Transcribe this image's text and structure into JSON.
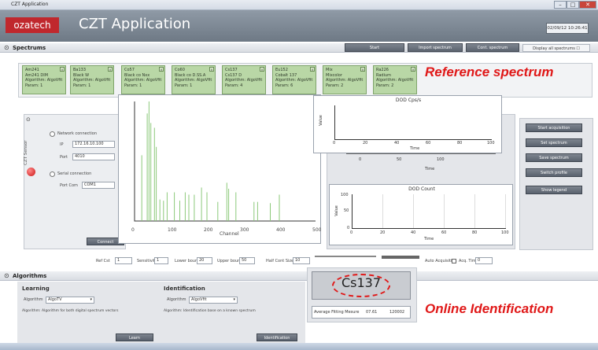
{
  "window": {
    "title": "CZT Application"
  },
  "header": {
    "logo": "ozatech",
    "app_title": "CZT Application",
    "datetime": "02/09/12 10:26:41"
  },
  "spectrums": {
    "label": "Spectrums",
    "buttons": [
      "Start",
      "Import spectrum",
      "Cont. spectrum",
      "Display all spectrums"
    ],
    "cards": [
      {
        "l1": "Am241",
        "l2": "Am241 DIM",
        "l3": "Algorithm: AlgoVfit",
        "l4": "Param: 1"
      },
      {
        "l1": "Ba133",
        "l2": "Black W",
        "l3": "Algorithm: AlgoVfit",
        "l4": "Param: 1"
      },
      {
        "l1": "Co57",
        "l2": "Black co Nxx",
        "l3": "Algorithm: AlgoVfit",
        "l4": "Param: 1"
      },
      {
        "l1": "Co60",
        "l2": "Black co D.SS.A",
        "l3": "Algorithm: AlgoVfit",
        "l4": "Param: 1"
      },
      {
        "l1": "Cs137",
        "l2": "Cs137 D",
        "l3": "Algorithm: AlgoVfit",
        "l4": "Param: 4"
      },
      {
        "l1": "Eu152",
        "l2": "Cobalt 137",
        "l3": "Algorithm: AlgoVfit",
        "l4": "Param: 6"
      },
      {
        "l1": "Mix",
        "l2": "Mixcolor",
        "l3": "Algorithm: AlgoVfit",
        "l4": "Param: 2"
      },
      {
        "l1": "Ra226",
        "l2": "Radium",
        "l3": "Algorithm: AlgoVfit",
        "l4": "Param: 2"
      }
    ],
    "reference_label": "Reference spectrum"
  },
  "czt": {
    "section_label": "CZT Sensor",
    "network_label": "Network connection",
    "ip_label": "IP",
    "ip_value": "172.16.10.100",
    "port_label": "Port",
    "port_value": "4010",
    "serial_label": "Serial connection",
    "port_name_label": "Port Com",
    "port_name_value": "COM1",
    "connect_btn": "Connect"
  },
  "plots": {
    "main_xlabel": "Channel",
    "main_xticks": [
      "0",
      "100",
      "200",
      "300",
      "400",
      "500"
    ],
    "top_title": "DOD Cps/s",
    "top_ylabel": "Value",
    "top_xlabel": "Time",
    "top_xticks": [
      "0",
      "20",
      "40",
      "60",
      "80",
      "100"
    ],
    "mid_xlabel": "Time",
    "mid_xticks": [
      "0",
      "50",
      "100"
    ],
    "bottom_title": "DOD Count",
    "bottom_ylabel": "Value",
    "bottom_xlabel": "Time",
    "bottom_yticks": [
      "100",
      "50",
      "0"
    ],
    "bottom_xticks": [
      "0",
      "20",
      "40",
      "60",
      "80",
      "100"
    ]
  },
  "chart_data": [
    {
      "type": "line",
      "title": "",
      "xlabel": "Channel",
      "ylabel": "",
      "xlim": [
        0,
        500
      ],
      "series": [
        {
          "x": [
            20,
            35,
            40,
            45,
            55,
            60,
            70,
            80,
            90,
            110,
            125,
            140,
            150,
            165,
            185,
            200,
            230,
            255,
            260,
            280,
            330,
            340,
            375,
            400
          ],
          "y": [
            0.55,
            0.9,
            1.0,
            0.82,
            0.78,
            0.62,
            0.18,
            0.17,
            0.24,
            0.24,
            0.17,
            0.24,
            0.22,
            0.22,
            0.28,
            0.24,
            0.16,
            0.32,
            0.27,
            0.24,
            0.16,
            0.16,
            0.15,
            0.22
          ]
        }
      ]
    }
  ],
  "side_buttons": [
    "Start acquisition",
    "Set spectrum",
    "Save spectrum",
    "Switch profile",
    "Show legend"
  ],
  "params": {
    "items": [
      {
        "label": "Ref Cst",
        "value": "1"
      },
      {
        "label": "Sensitivity",
        "value": "1"
      },
      {
        "label": "Lower bound",
        "value": "20"
      },
      {
        "label": "Upper bound",
        "value": "50"
      },
      {
        "label": "Half Cont Size",
        "value": "10"
      }
    ],
    "auto_acq_label": "Auto Acquisition",
    "acq_time_label": "Acq. Time",
    "acq_time_value": "0"
  },
  "algorithms": {
    "section_label": "Algorithms",
    "learning_title": "Learning",
    "learning_algo_label": "Algorithm",
    "learning_algo_value": "AlgoTV",
    "learning_desc": "Algorithm: Algorithm for both digital spectrum vectors",
    "learn_btn": "Learn",
    "ident_title": "Identification",
    "ident_algo_label": "Algorithm",
    "ident_algo_value": "AlgoVfit",
    "ident_desc": "Algorithm: Identification base on a known spectrum",
    "ident_btn": "Identification"
  },
  "identification": {
    "result": "Cs137",
    "avg_label": "Average Fitting Mesure",
    "avg_value": "07.61",
    "count_value": "120002",
    "online_label": "Online Identification"
  }
}
